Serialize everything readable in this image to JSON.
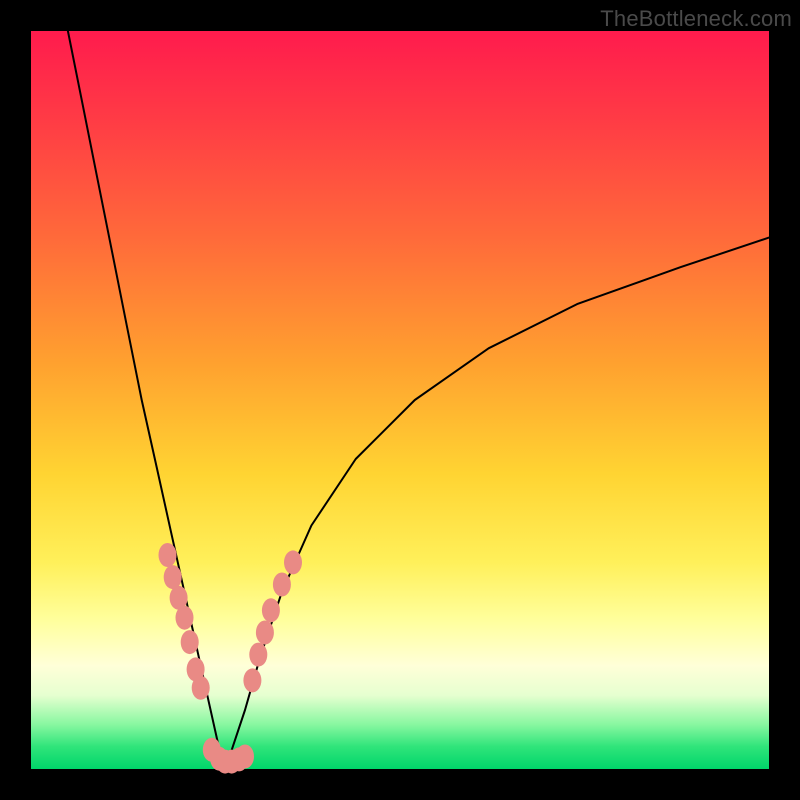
{
  "watermark": "TheBottleneck.com",
  "colors": {
    "curve_stroke": "#000000",
    "marker_fill": "#e98a85",
    "marker_stroke": "#cc6f6b"
  },
  "chart_data": {
    "type": "line",
    "title": "",
    "xlabel": "",
    "ylabel": "",
    "xlim": [
      0,
      100
    ],
    "ylim": [
      0,
      100
    ],
    "grid": false,
    "legend": false,
    "note": "Axes are unlabeled; values estimated from pixel positions as percentages of plot area. Curve looks like a V-shaped bottleneck curve reaching ~0 near x≈26 then rising asymptotically toward ~72%. Markers are clustered along both arms near the valley.",
    "series": [
      {
        "name": "curve",
        "kind": "line",
        "x": [
          5,
          7,
          9,
          11,
          13,
          15,
          17,
          19,
          21,
          23,
          25,
          26,
          27,
          29,
          31,
          34,
          38,
          44,
          52,
          62,
          74,
          88,
          100
        ],
        "y": [
          100,
          90,
          80,
          70,
          60,
          50,
          41,
          32,
          23,
          14,
          5,
          0.5,
          2,
          8,
          15,
          24,
          33,
          42,
          50,
          57,
          63,
          68,
          72
        ]
      },
      {
        "name": "markers-left-arm",
        "kind": "scatter",
        "x": [
          18.5,
          19.2,
          20.0,
          20.8,
          21.5,
          22.3,
          23.0
        ],
        "y": [
          29.0,
          26.0,
          23.2,
          20.5,
          17.2,
          13.5,
          11.0
        ]
      },
      {
        "name": "markers-valley",
        "kind": "scatter",
        "x": [
          24.5,
          25.5,
          26.3,
          27.2,
          28.2,
          29.0
        ],
        "y": [
          2.6,
          1.4,
          1.0,
          1.0,
          1.3,
          1.7
        ]
      },
      {
        "name": "markers-right-arm",
        "kind": "scatter",
        "x": [
          30.0,
          30.8,
          31.7,
          32.5,
          34.0,
          35.5
        ],
        "y": [
          12.0,
          15.5,
          18.5,
          21.5,
          25.0,
          28.0
        ]
      }
    ]
  }
}
